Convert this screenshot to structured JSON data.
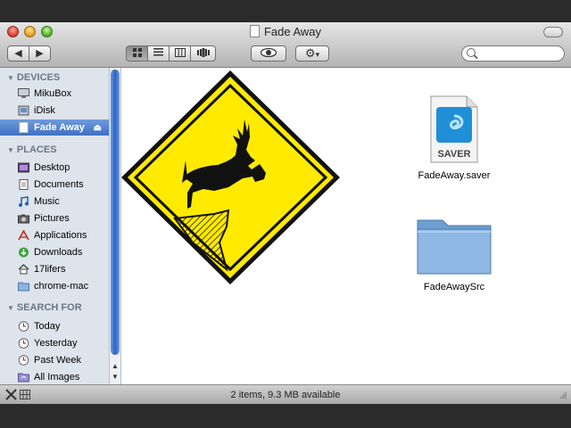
{
  "window": {
    "title": "Fade Away"
  },
  "toolbar": {
    "back_label": "◀",
    "forward_label": "▶",
    "views": [
      "icon-view-icon",
      "list-view-icon",
      "column-view-icon",
      "coverflow-view-icon"
    ],
    "quicklook_label": "",
    "action_label": "▾"
  },
  "search": {
    "value": "",
    "placeholder": ""
  },
  "sidebar": {
    "devices_header": "DEVICES",
    "devices": [
      {
        "label": "MikuBox",
        "icon": "computer-icon"
      },
      {
        "label": "iDisk",
        "icon": "idisk-icon"
      },
      {
        "label": "Fade Away",
        "icon": "disk-image-icon",
        "selected": true
      }
    ],
    "places_header": "PLACES",
    "places": [
      {
        "label": "Desktop",
        "icon": "desktop-folder-icon"
      },
      {
        "label": "Documents",
        "icon": "documents-folder-icon"
      },
      {
        "label": "Music",
        "icon": "music-folder-icon"
      },
      {
        "label": "Pictures",
        "icon": "pictures-folder-icon"
      },
      {
        "label": "Applications",
        "icon": "applications-folder-icon"
      },
      {
        "label": "Downloads",
        "icon": "downloads-folder-icon"
      },
      {
        "label": "17lifers",
        "icon": "home-icon"
      },
      {
        "label": "chrome-mac",
        "icon": "folder-icon"
      }
    ],
    "search_header": "SEARCH FOR",
    "searches": [
      {
        "label": "Today",
        "icon": "clock-icon"
      },
      {
        "label": "Yesterday",
        "icon": "clock-icon"
      },
      {
        "label": "Past Week",
        "icon": "clock-icon"
      },
      {
        "label": "All Images",
        "icon": "smart-folder-icon"
      }
    ]
  },
  "content": {
    "files": [
      {
        "name": "FadeAway.saver",
        "badge": "SAVER"
      },
      {
        "name": "FadeAwaySrc"
      }
    ]
  },
  "statusbar": {
    "text": "2 items, 9.3 MB available"
  },
  "colors": {
    "selection": "#3f6fc4",
    "sidebar_bg": "#dde4ec",
    "sign_yellow": "#ffea00"
  }
}
